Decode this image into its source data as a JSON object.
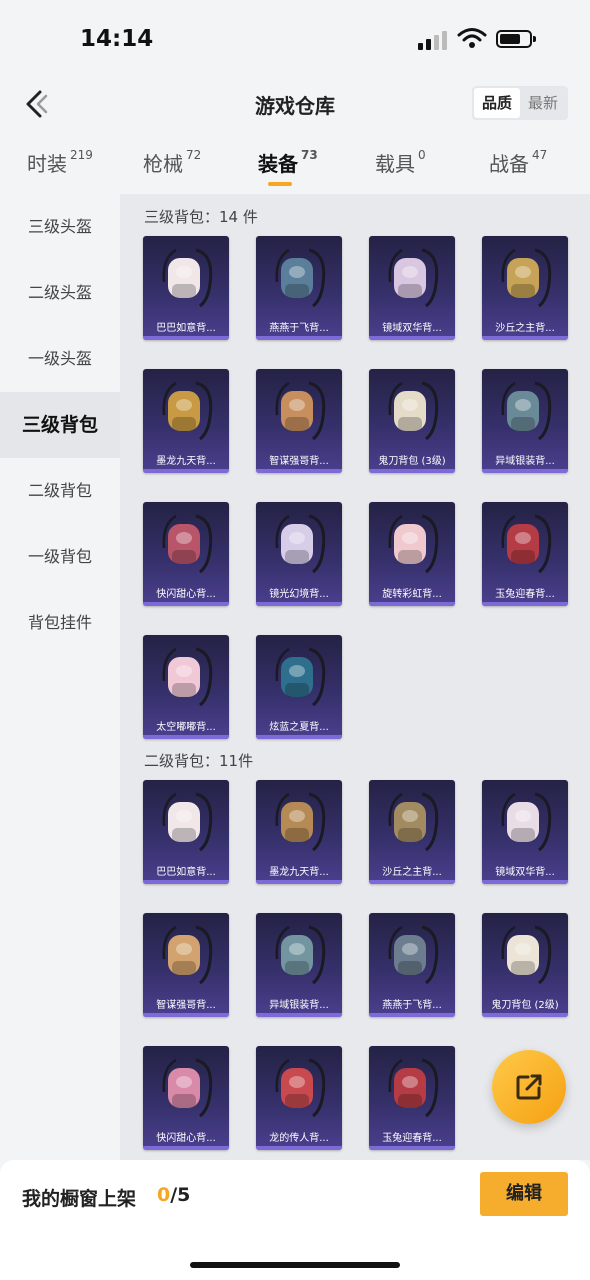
{
  "status": {
    "time": "14:14"
  },
  "nav": {
    "title": "游戏仓库",
    "sort_quality": "品质",
    "sort_newest": "最新"
  },
  "tabs": [
    {
      "label": "时装",
      "count": "219"
    },
    {
      "label": "枪械",
      "count": "72"
    },
    {
      "label": "装备",
      "count": "73"
    },
    {
      "label": "载具",
      "count": "0"
    },
    {
      "label": "战备",
      "count": "47"
    }
  ],
  "sidebar": [
    {
      "label": "三级头盔"
    },
    {
      "label": "二级头盔"
    },
    {
      "label": "一级头盔"
    },
    {
      "label": "三级背包"
    },
    {
      "label": "二级背包"
    },
    {
      "label": "一级背包"
    },
    {
      "label": "背包挂件"
    }
  ],
  "sections": [
    {
      "title": "三级背包：14 件",
      "items": [
        {
          "name": "巴巴如意背...",
          "icon": "white-bunny-backpack-icon",
          "color": "#f1e7e9"
        },
        {
          "name": "燕燕于飞背...",
          "icon": "swallow-backpack-icon",
          "color": "#5b7f9a"
        },
        {
          "name": "镜域双华背...",
          "icon": "mirror-heart-backpack-icon",
          "color": "#d9c6e0"
        },
        {
          "name": "沙丘之主背...",
          "icon": "dune-lord-backpack-icon",
          "color": "#c6a356"
        },
        {
          "name": "墨龙九天背...",
          "icon": "ink-dragon-backpack-icon",
          "color": "#c89a43"
        },
        {
          "name": "智谋强哥背...",
          "icon": "smart-brother-backpack-icon",
          "color": "#c78f5e"
        },
        {
          "name": "鬼刀背包 (3级)",
          "icon": "ghost-blade-backpack-icon",
          "color": "#e5dbc9"
        },
        {
          "name": "异域银装背...",
          "icon": "silver-armor-backpack-icon",
          "color": "#6b8a98"
        },
        {
          "name": "快闪甜心背...",
          "icon": "sweetheart-backpack-icon",
          "color": "#b85569"
        },
        {
          "name": "镜光幻境背...",
          "icon": "mirror-light-backpack-icon",
          "color": "#d7cde8"
        },
        {
          "name": "旋转彩虹背...",
          "icon": "rainbow-backpack-icon",
          "color": "#f0c9cf"
        },
        {
          "name": "玉兔迎春背...",
          "icon": "jade-rabbit-backpack-icon",
          "color": "#b53b45"
        },
        {
          "name": "太空嘟嘟背...",
          "icon": "space-dudu-backpack-icon",
          "color": "#f1c8d6"
        },
        {
          "name": "炫蓝之夏背...",
          "icon": "blue-summer-backpack-icon",
          "color": "#2f6f8e"
        }
      ]
    },
    {
      "title": "二级背包：11件",
      "items": [
        {
          "name": "巴巴如意背...",
          "icon": "white-bunny-backpack-icon",
          "color": "#f1e7e9"
        },
        {
          "name": "墨龙九天背...",
          "icon": "ink-dragon-backpack-icon",
          "color": "#b58a55"
        },
        {
          "name": "沙丘之主背...",
          "icon": "dune-lord-backpack-icon",
          "color": "#a28b60"
        },
        {
          "name": "镜域双华背...",
          "icon": "mirror-heart-backpack-icon",
          "color": "#e8dde6"
        },
        {
          "name": "智谋强哥背...",
          "icon": "smart-brother-backpack-icon",
          "color": "#d2a36e"
        },
        {
          "name": "异域银装背...",
          "icon": "silver-armor-backpack-icon",
          "color": "#7295a0"
        },
        {
          "name": "燕燕于飞背...",
          "icon": "swallow-backpack-icon",
          "color": "#6b7d8e"
        },
        {
          "name": "鬼刀背包 (2级)",
          "icon": "ghost-blade-backpack-icon",
          "color": "#ece4d6"
        },
        {
          "name": "快闪甜心背...",
          "icon": "sweetheart-backpack-icon",
          "color": "#d98aa8"
        },
        {
          "name": "龙的传人背...",
          "icon": "dragon-heir-backpack-icon",
          "color": "#c8494e"
        },
        {
          "name": "玉兔迎春背...",
          "icon": "jade-rabbit-backpack-icon",
          "color": "#b53b45"
        }
      ]
    }
  ],
  "footer": {
    "shelf_label": "我的橱窗上架",
    "shelf_current": "0",
    "shelf_total": "/5",
    "edit_label": "编辑"
  },
  "colors": {
    "accent": "#f5a623",
    "card_bg": "#35306a"
  }
}
